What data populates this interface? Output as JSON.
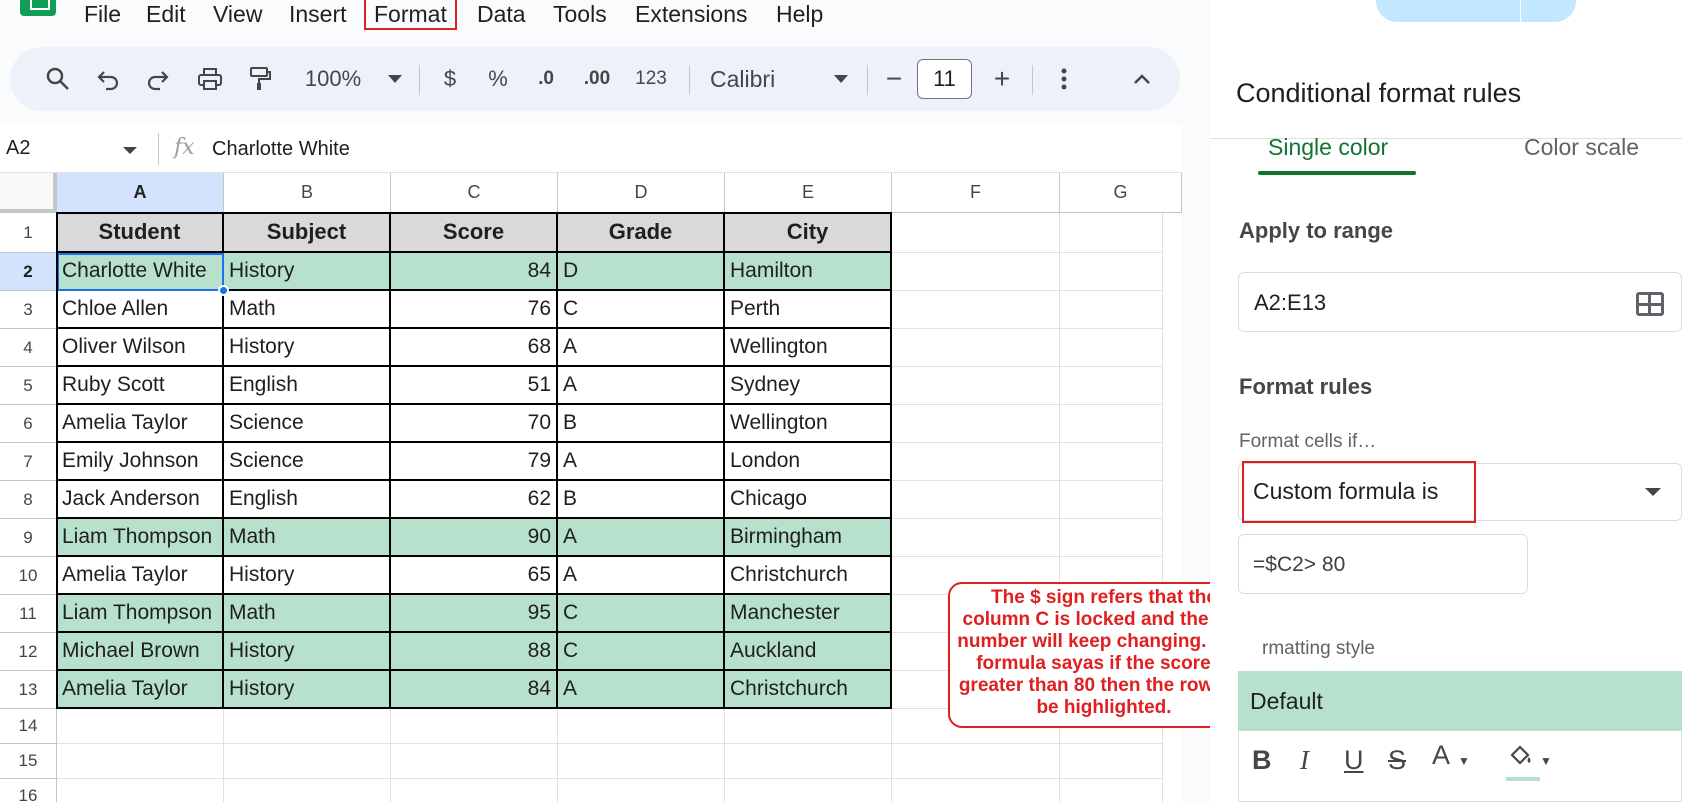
{
  "menu": {
    "items": [
      "File",
      "Edit",
      "View",
      "Insert",
      "Format",
      "Data",
      "Tools",
      "Extensions",
      "Help"
    ]
  },
  "toolbar": {
    "zoom": "100%",
    "currency": "$",
    "percent": "%",
    "decrease_decimal": ".0",
    "increase_decimal": ".00",
    "number_format": "123",
    "font": "Calibri",
    "font_size": "11",
    "minus": "−",
    "plus": "+"
  },
  "formula_bar": {
    "cell_ref": "A2",
    "fx": "fx",
    "value": "Charlotte White"
  },
  "sheet": {
    "columns": [
      "A",
      "B",
      "C",
      "D",
      "E",
      "F",
      "G"
    ],
    "rows": [
      "1",
      "2",
      "3",
      "4",
      "5",
      "6",
      "7",
      "8",
      "9",
      "10",
      "11",
      "12",
      "13",
      "14",
      "15",
      "16"
    ],
    "headers": [
      "Student",
      "Subject",
      "Score",
      "Grade",
      "City"
    ],
    "data": [
      [
        "Charlotte White",
        "History",
        "84",
        "D",
        "Hamilton"
      ],
      [
        "Chloe Allen",
        "Math",
        "76",
        "C",
        "Perth"
      ],
      [
        "Oliver Wilson",
        "History",
        "68",
        "A",
        "Wellington"
      ],
      [
        "Ruby Scott",
        "English",
        "51",
        "A",
        "Sydney"
      ],
      [
        "Amelia Taylor",
        "Science",
        "70",
        "B",
        "Wellington"
      ],
      [
        "Emily Johnson",
        "Science",
        "79",
        "A",
        "London"
      ],
      [
        "Jack Anderson",
        "English",
        "62",
        "B",
        "Chicago"
      ],
      [
        "Liam Thompson",
        "Math",
        "90",
        "A",
        "Birmingham"
      ],
      [
        "Amelia Taylor",
        "History",
        "65",
        "A",
        "Christchurch"
      ],
      [
        "Liam Thompson",
        "Math",
        "95",
        "C",
        "Manchester"
      ],
      [
        "Michael Brown",
        "History",
        "88",
        "C",
        "Auckland"
      ],
      [
        "Amelia Taylor",
        "History",
        "84",
        "A",
        "Christchurch"
      ]
    ],
    "highlighted_rows": [
      true,
      false,
      false,
      false,
      false,
      false,
      false,
      true,
      false,
      true,
      true,
      true
    ],
    "highlight_color": "#b7e1cd",
    "header_fill": "#d9d9d9"
  },
  "annotation": {
    "text": "The $ sign refers that the column C is locked and the cell number will keep changing. This formula sayas if the score is greater than 80 then the row will be highlighted.",
    "color": "#e02020"
  },
  "panel": {
    "title": "Conditional format rules",
    "tabs": [
      "Single color",
      "Color scale"
    ],
    "apply_to_range_label": "Apply to range",
    "range_value": "A2:E13",
    "format_rules_label": "Format rules",
    "format_cells_if_label": "Format cells if…",
    "condition": "Custom formula is",
    "formula_value": "=$C2> 80",
    "formatting_style_label": "rmatting style",
    "style_preview": "Default",
    "style_buttons": [
      "B",
      "I",
      "U",
      "S",
      "A"
    ],
    "accent": "#137333"
  }
}
